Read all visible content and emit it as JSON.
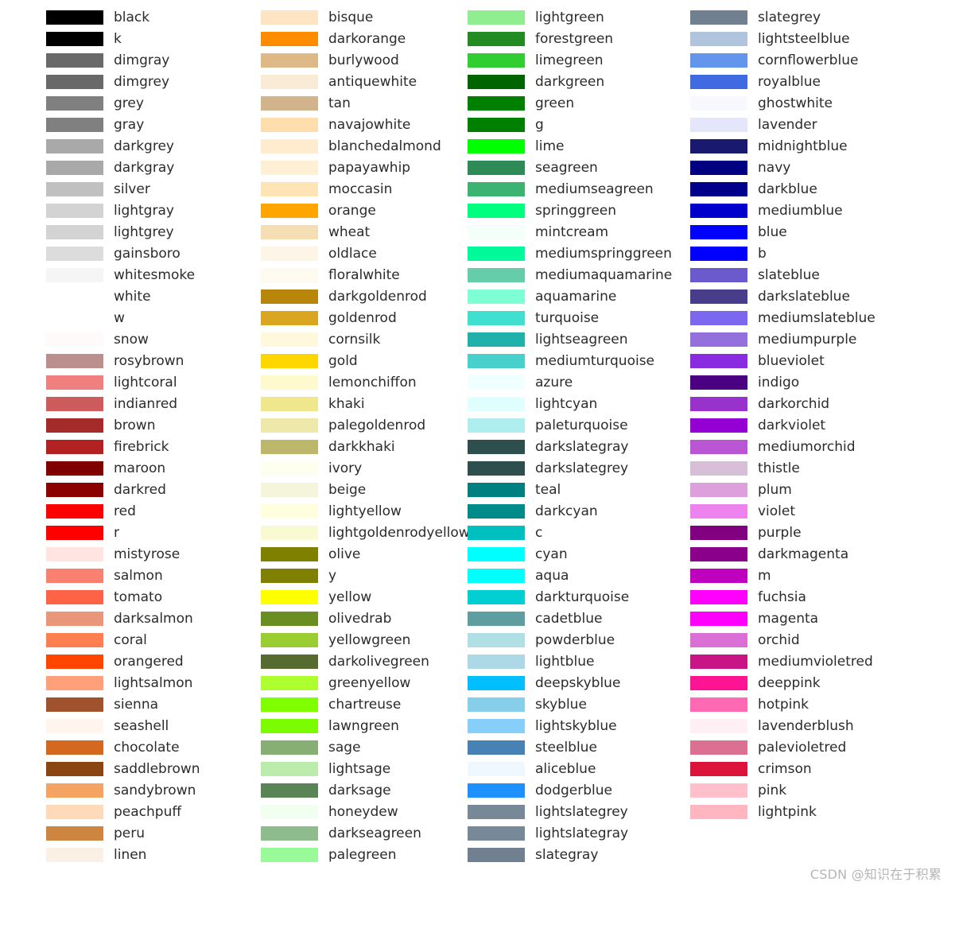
{
  "watermark": "CSDN @知识在于积累",
  "columns": [
    [
      {
        "name": "black",
        "hex": "#000000"
      },
      {
        "name": "k",
        "hex": "#000000"
      },
      {
        "name": "dimgray",
        "hex": "#696969"
      },
      {
        "name": "dimgrey",
        "hex": "#696969"
      },
      {
        "name": "grey",
        "hex": "#808080"
      },
      {
        "name": "gray",
        "hex": "#808080"
      },
      {
        "name": "darkgrey",
        "hex": "#A9A9A9"
      },
      {
        "name": "darkgray",
        "hex": "#A9A9A9"
      },
      {
        "name": "silver",
        "hex": "#C0C0C0"
      },
      {
        "name": "lightgray",
        "hex": "#D3D3D3"
      },
      {
        "name": "lightgrey",
        "hex": "#D3D3D3"
      },
      {
        "name": "gainsboro",
        "hex": "#DCDCDC"
      },
      {
        "name": "whitesmoke",
        "hex": "#F5F5F5"
      },
      {
        "name": "white",
        "hex": "#FFFFFF"
      },
      {
        "name": "w",
        "hex": "#FFFFFF"
      },
      {
        "name": "snow",
        "hex": "#FFFAFA"
      },
      {
        "name": "rosybrown",
        "hex": "#BC8F8F"
      },
      {
        "name": "lightcoral",
        "hex": "#F08080"
      },
      {
        "name": "indianred",
        "hex": "#CD5C5C"
      },
      {
        "name": "brown",
        "hex": "#A52A2A"
      },
      {
        "name": "firebrick",
        "hex": "#B22222"
      },
      {
        "name": "maroon",
        "hex": "#800000"
      },
      {
        "name": "darkred",
        "hex": "#8B0000"
      },
      {
        "name": "red",
        "hex": "#FF0000"
      },
      {
        "name": "r",
        "hex": "#FF0000"
      },
      {
        "name": "mistyrose",
        "hex": "#FFE4E1"
      },
      {
        "name": "salmon",
        "hex": "#FA8072"
      },
      {
        "name": "tomato",
        "hex": "#FF6347"
      },
      {
        "name": "darksalmon",
        "hex": "#E9967A"
      },
      {
        "name": "coral",
        "hex": "#FF7F50"
      },
      {
        "name": "orangered",
        "hex": "#FF4500"
      },
      {
        "name": "lightsalmon",
        "hex": "#FFA07A"
      },
      {
        "name": "sienna",
        "hex": "#A0522D"
      },
      {
        "name": "seashell",
        "hex": "#FFF5EE"
      },
      {
        "name": "chocolate",
        "hex": "#D2691E"
      },
      {
        "name": "saddlebrown",
        "hex": "#8B4513"
      },
      {
        "name": "sandybrown",
        "hex": "#F4A460"
      },
      {
        "name": "peachpuff",
        "hex": "#FFDAB9"
      },
      {
        "name": "peru",
        "hex": "#CD853F"
      },
      {
        "name": "linen",
        "hex": "#FAF0E6"
      }
    ],
    [
      {
        "name": "bisque",
        "hex": "#FFE4C4"
      },
      {
        "name": "darkorange",
        "hex": "#FF8C00"
      },
      {
        "name": "burlywood",
        "hex": "#DEB887"
      },
      {
        "name": "antiquewhite",
        "hex": "#FAEBD7"
      },
      {
        "name": "tan",
        "hex": "#D2B48C"
      },
      {
        "name": "navajowhite",
        "hex": "#FFDEAD"
      },
      {
        "name": "blanchedalmond",
        "hex": "#FFEBCD"
      },
      {
        "name": "papayawhip",
        "hex": "#FFEFD5"
      },
      {
        "name": "moccasin",
        "hex": "#FFE4B5"
      },
      {
        "name": "orange",
        "hex": "#FFA500"
      },
      {
        "name": "wheat",
        "hex": "#F5DEB3"
      },
      {
        "name": "oldlace",
        "hex": "#FDF5E6"
      },
      {
        "name": "floralwhite",
        "hex": "#FFFAF0"
      },
      {
        "name": "darkgoldenrod",
        "hex": "#B8860B"
      },
      {
        "name": "goldenrod",
        "hex": "#DAA520"
      },
      {
        "name": "cornsilk",
        "hex": "#FFF8DC"
      },
      {
        "name": "gold",
        "hex": "#FFD700"
      },
      {
        "name": "lemonchiffon",
        "hex": "#FFFACD"
      },
      {
        "name": "khaki",
        "hex": "#F0E68C"
      },
      {
        "name": "palegoldenrod",
        "hex": "#EEE8AA"
      },
      {
        "name": "darkkhaki",
        "hex": "#BDB76B"
      },
      {
        "name": "ivory",
        "hex": "#FFFFF0"
      },
      {
        "name": "beige",
        "hex": "#F5F5DC"
      },
      {
        "name": "lightyellow",
        "hex": "#FFFFE0"
      },
      {
        "name": "lightgoldenrodyellow",
        "hex": "#FAFAD2"
      },
      {
        "name": "olive",
        "hex": "#808000"
      },
      {
        "name": "y",
        "hex": "#808000"
      },
      {
        "name": "yellow",
        "hex": "#FFFF00"
      },
      {
        "name": "olivedrab",
        "hex": "#6B8E23"
      },
      {
        "name": "yellowgreen",
        "hex": "#9ACD32"
      },
      {
        "name": "darkolivegreen",
        "hex": "#556B2F"
      },
      {
        "name": "greenyellow",
        "hex": "#ADFF2F"
      },
      {
        "name": "chartreuse",
        "hex": "#7FFF00"
      },
      {
        "name": "lawngreen",
        "hex": "#7CFC00"
      },
      {
        "name": "sage",
        "hex": "#87AE73"
      },
      {
        "name": "lightsage",
        "hex": "#BCECAC"
      },
      {
        "name": "darksage",
        "hex": "#598556"
      },
      {
        "name": "honeydew",
        "hex": "#F0FFF0"
      },
      {
        "name": "darkseagreen",
        "hex": "#8FBC8F"
      },
      {
        "name": "palegreen",
        "hex": "#98FB98"
      }
    ],
    [
      {
        "name": "lightgreen",
        "hex": "#90EE90"
      },
      {
        "name": "forestgreen",
        "hex": "#228B22"
      },
      {
        "name": "limegreen",
        "hex": "#32CD32"
      },
      {
        "name": "darkgreen",
        "hex": "#006400"
      },
      {
        "name": "green",
        "hex": "#008000"
      },
      {
        "name": "g",
        "hex": "#008000"
      },
      {
        "name": "lime",
        "hex": "#00FF00"
      },
      {
        "name": "seagreen",
        "hex": "#2E8B57"
      },
      {
        "name": "mediumseagreen",
        "hex": "#3CB371"
      },
      {
        "name": "springgreen",
        "hex": "#00FF7F"
      },
      {
        "name": "mintcream",
        "hex": "#F5FFFA"
      },
      {
        "name": "mediumspringgreen",
        "hex": "#00FA9A"
      },
      {
        "name": "mediumaquamarine",
        "hex": "#66CDAA"
      },
      {
        "name": "aquamarine",
        "hex": "#7FFFD4"
      },
      {
        "name": "turquoise",
        "hex": "#40E0D0"
      },
      {
        "name": "lightseagreen",
        "hex": "#20B2AA"
      },
      {
        "name": "mediumturquoise",
        "hex": "#48D1CC"
      },
      {
        "name": "azure",
        "hex": "#F0FFFF"
      },
      {
        "name": "lightcyan",
        "hex": "#E0FFFF"
      },
      {
        "name": "paleturquoise",
        "hex": "#AFEEEE"
      },
      {
        "name": "darkslategray",
        "hex": "#2F4F4F"
      },
      {
        "name": "darkslategrey",
        "hex": "#2F4F4F"
      },
      {
        "name": "teal",
        "hex": "#008080"
      },
      {
        "name": "darkcyan",
        "hex": "#008B8B"
      },
      {
        "name": "c",
        "hex": "#00BFBF"
      },
      {
        "name": "cyan",
        "hex": "#00FFFF"
      },
      {
        "name": "aqua",
        "hex": "#00FFFF"
      },
      {
        "name": "darkturquoise",
        "hex": "#00CED1"
      },
      {
        "name": "cadetblue",
        "hex": "#5F9EA0"
      },
      {
        "name": "powderblue",
        "hex": "#B0E0E6"
      },
      {
        "name": "lightblue",
        "hex": "#ADD8E6"
      },
      {
        "name": "deepskyblue",
        "hex": "#00BFFF"
      },
      {
        "name": "skyblue",
        "hex": "#87CEEB"
      },
      {
        "name": "lightskyblue",
        "hex": "#87CEFA"
      },
      {
        "name": "steelblue",
        "hex": "#4682B4"
      },
      {
        "name": "aliceblue",
        "hex": "#F0F8FF"
      },
      {
        "name": "dodgerblue",
        "hex": "#1E90FF"
      },
      {
        "name": "lightslategrey",
        "hex": "#778899"
      },
      {
        "name": "lightslategray",
        "hex": "#778899"
      },
      {
        "name": "slategray",
        "hex": "#708090"
      }
    ],
    [
      {
        "name": "slategrey",
        "hex": "#708090"
      },
      {
        "name": "lightsteelblue",
        "hex": "#B0C4DE"
      },
      {
        "name": "cornflowerblue",
        "hex": "#6495ED"
      },
      {
        "name": "royalblue",
        "hex": "#4169E1"
      },
      {
        "name": "ghostwhite",
        "hex": "#F8F8FF"
      },
      {
        "name": "lavender",
        "hex": "#E6E6FA"
      },
      {
        "name": "midnightblue",
        "hex": "#191970"
      },
      {
        "name": "navy",
        "hex": "#000080"
      },
      {
        "name": "darkblue",
        "hex": "#00008B"
      },
      {
        "name": "mediumblue",
        "hex": "#0000CD"
      },
      {
        "name": "blue",
        "hex": "#0000FF"
      },
      {
        "name": "b",
        "hex": "#0000FF"
      },
      {
        "name": "slateblue",
        "hex": "#6A5ACD"
      },
      {
        "name": "darkslateblue",
        "hex": "#483D8B"
      },
      {
        "name": "mediumslateblue",
        "hex": "#7B68EE"
      },
      {
        "name": "mediumpurple",
        "hex": "#9370DB"
      },
      {
        "name": "blueviolet",
        "hex": "#8A2BE2"
      },
      {
        "name": "indigo",
        "hex": "#4B0082"
      },
      {
        "name": "darkorchid",
        "hex": "#9932CC"
      },
      {
        "name": "darkviolet",
        "hex": "#9400D3"
      },
      {
        "name": "mediumorchid",
        "hex": "#BA55D3"
      },
      {
        "name": "thistle",
        "hex": "#D8BFD8"
      },
      {
        "name": "plum",
        "hex": "#DDA0DD"
      },
      {
        "name": "violet",
        "hex": "#EE82EE"
      },
      {
        "name": "purple",
        "hex": "#800080"
      },
      {
        "name": "darkmagenta",
        "hex": "#8B008B"
      },
      {
        "name": "m",
        "hex": "#BF00BF"
      },
      {
        "name": "fuchsia",
        "hex": "#FF00FF"
      },
      {
        "name": "magenta",
        "hex": "#FF00FF"
      },
      {
        "name": "orchid",
        "hex": "#DA70D6"
      },
      {
        "name": "mediumvioletred",
        "hex": "#C71585"
      },
      {
        "name": "deeppink",
        "hex": "#FF1493"
      },
      {
        "name": "hotpink",
        "hex": "#FF69B4"
      },
      {
        "name": "lavenderblush",
        "hex": "#FFF0F5"
      },
      {
        "name": "palevioletred",
        "hex": "#DB7093"
      },
      {
        "name": "crimson",
        "hex": "#DC143C"
      },
      {
        "name": "pink",
        "hex": "#FFC0CB"
      },
      {
        "name": "lightpink",
        "hex": "#FFB6C1"
      }
    ]
  ]
}
